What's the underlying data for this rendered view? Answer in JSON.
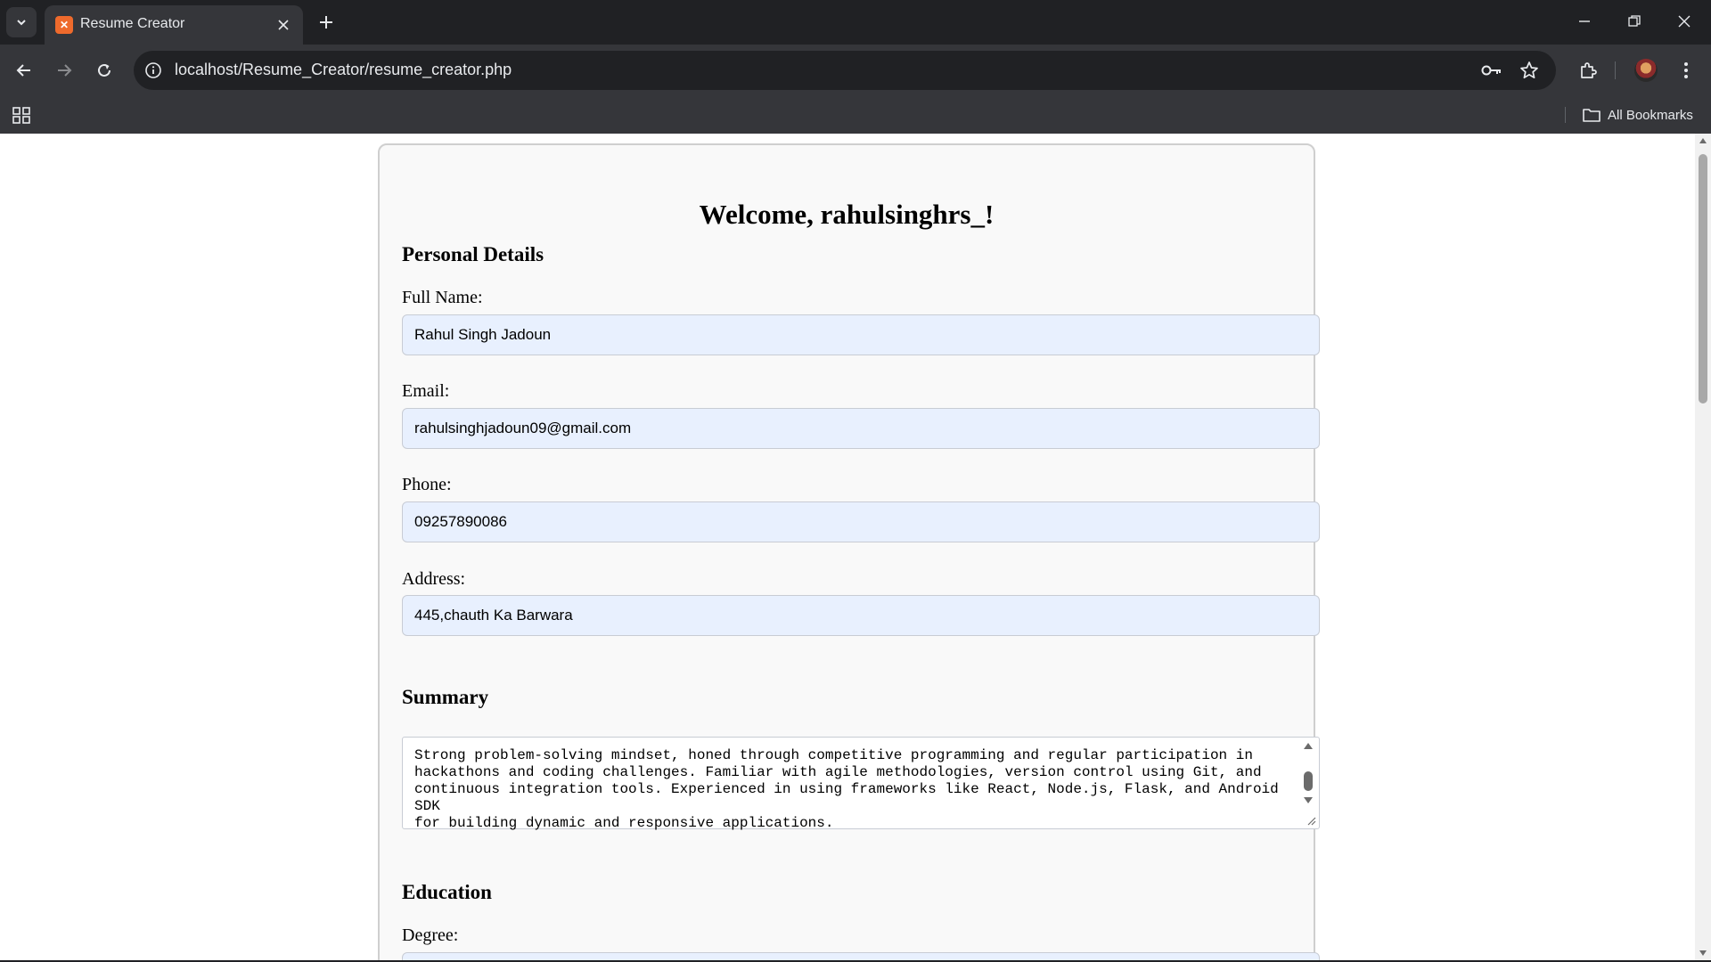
{
  "browser": {
    "tab": {
      "title": "Resume Creator",
      "favicon": "xampp-icon"
    },
    "url": "localhost/Resume_Creator/resume_creator.php",
    "bookmarks": {
      "all_label": "All Bookmarks"
    }
  },
  "page": {
    "welcome": "Welcome, rahulsinghrs_!",
    "personal": {
      "heading": "Personal Details",
      "full_name_label": "Full Name:",
      "full_name": "Rahul Singh Jadoun",
      "email_label": "Email:",
      "email": "rahulsinghjadoun09@gmail.com",
      "phone_label": "Phone:",
      "phone": "09257890086",
      "address_label": "Address:",
      "address": "445,chauth Ka Barwara"
    },
    "summary": {
      "heading": "Summary",
      "text": "Strong problem-solving mindset, honed through competitive programming and regular participation in\nhackathons and coding challenges. Familiar with agile methodologies, version control using Git, and\ncontinuous integration tools. Experienced in using frameworks like React, Node.js, Flask, and Android SDK\nfor building dynamic and responsive applications."
    },
    "education": {
      "heading": "Education",
      "degree_label": "Degree:"
    }
  },
  "colors": {
    "chrome_dark": "#202124",
    "chrome_toolbar": "#35363a",
    "field_autofill": "#e8f0fe",
    "card_bg": "#f9f9f9"
  }
}
